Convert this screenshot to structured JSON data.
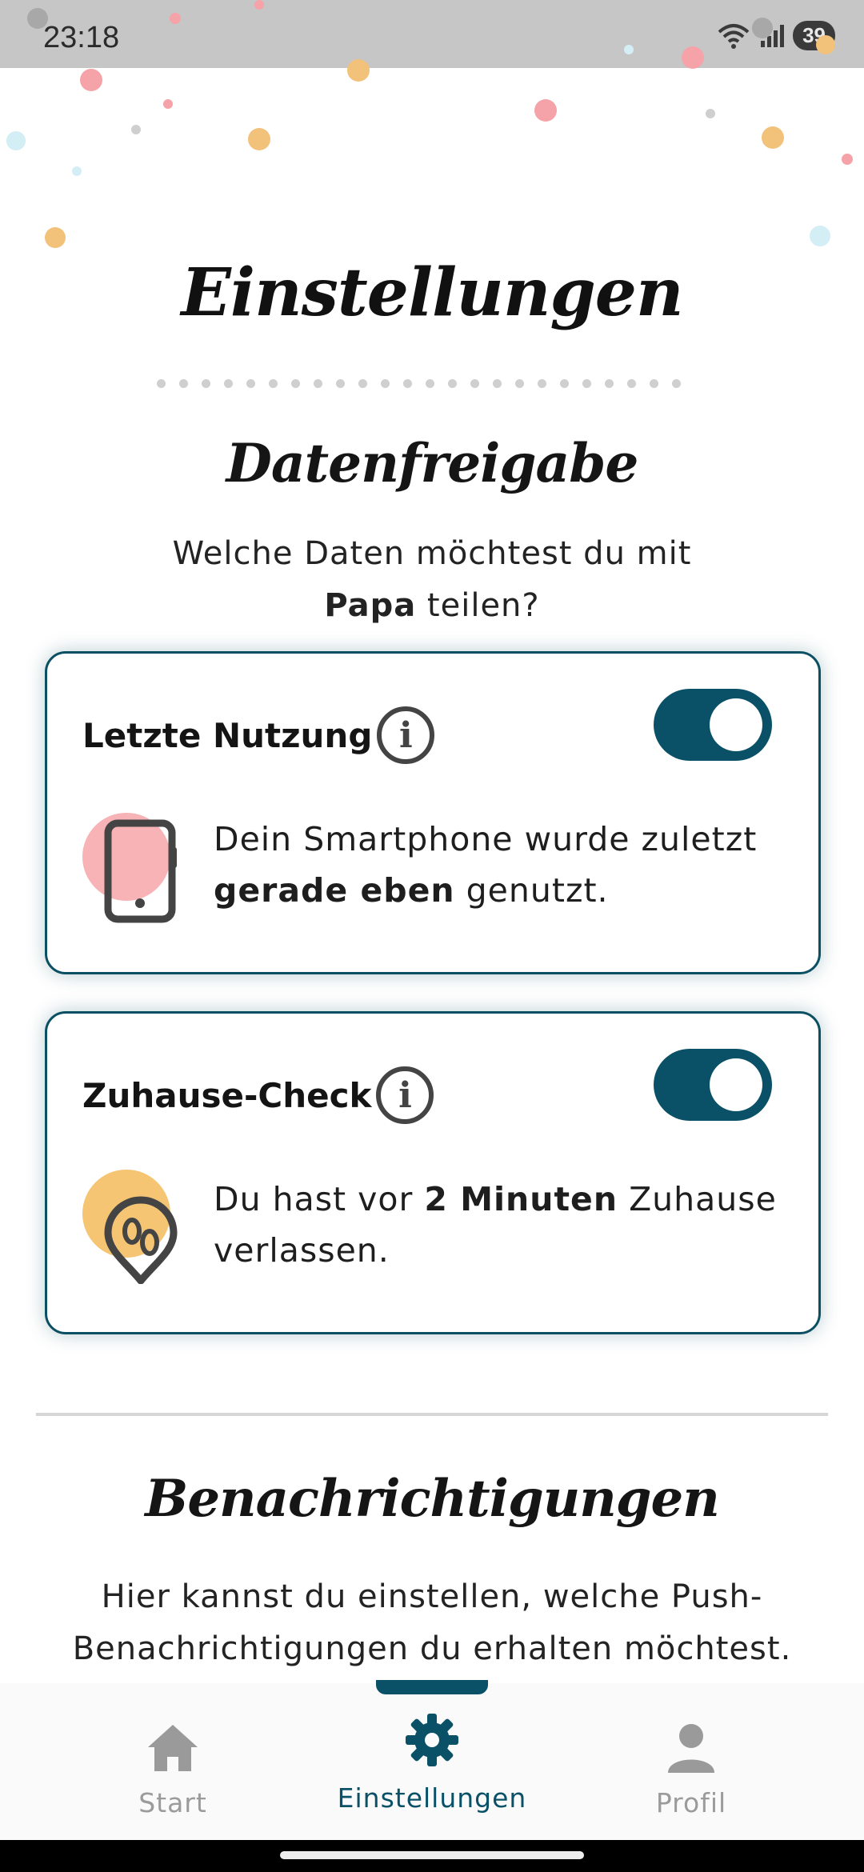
{
  "status_bar": {
    "time": "23:18",
    "battery": "39"
  },
  "page": {
    "title": "Einstellungen"
  },
  "data_sharing": {
    "title": "Datenfreigabe",
    "question_prefix": "Welche Daten möchtest du mit",
    "person": "Papa",
    "question_suffix": " teilen?",
    "cards": [
      {
        "title": "Letzte Nutzung",
        "enabled": true,
        "text_prefix": "Dein Smartphone wurde zuletzt ",
        "text_bold": "gerade eben",
        "text_suffix": " genutzt.",
        "icon": "smartphone-icon",
        "accent_color": "#f7b3b6"
      },
      {
        "title": "Zuhause-Check",
        "enabled": true,
        "text_prefix": "Du hast vor ",
        "text_bold": "2 Minuten",
        "text_suffix": " Zuhause verlassen.",
        "icon": "footprints-pin-icon",
        "accent_color": "#f5c574"
      }
    ]
  },
  "notifications": {
    "title": "Benachrichtigungen",
    "description": "Hier kannst du einstellen, welche Push-Benachrichtigungen du erhalten möchtest."
  },
  "bottom_nav": {
    "items": [
      {
        "label": "Start",
        "icon": "home-icon",
        "active": false
      },
      {
        "label": "Einstellungen",
        "icon": "gear-icon",
        "active": true
      },
      {
        "label": "Profil",
        "icon": "person-icon",
        "active": false
      }
    ]
  },
  "colors": {
    "primary": "#0a5168",
    "card_border": "#0b4f62",
    "confetti_pink": "#f5a3a8",
    "confetti_orange": "#f3c27a",
    "confetti_blue": "#d4eef6",
    "confetti_grey": "#cfcfcf"
  }
}
